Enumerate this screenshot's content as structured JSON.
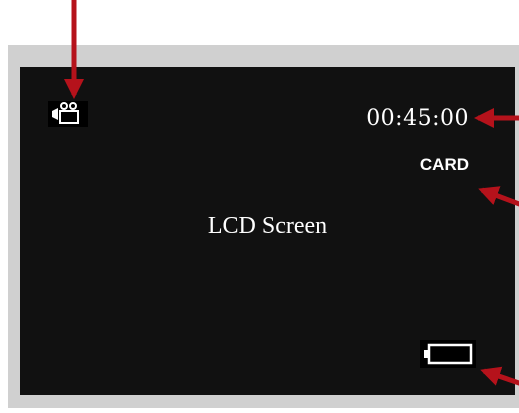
{
  "lcd": {
    "label": "LCD Screen",
    "time_display": "00:45:00",
    "storage_indicator": "CARD",
    "mode_icon": "video-camera-icon",
    "battery_icon": "battery-icon"
  },
  "colors": {
    "screen": "#111111",
    "frame": "#d0d0d0",
    "arrow": "#b5121b",
    "text": "#ffffff"
  }
}
